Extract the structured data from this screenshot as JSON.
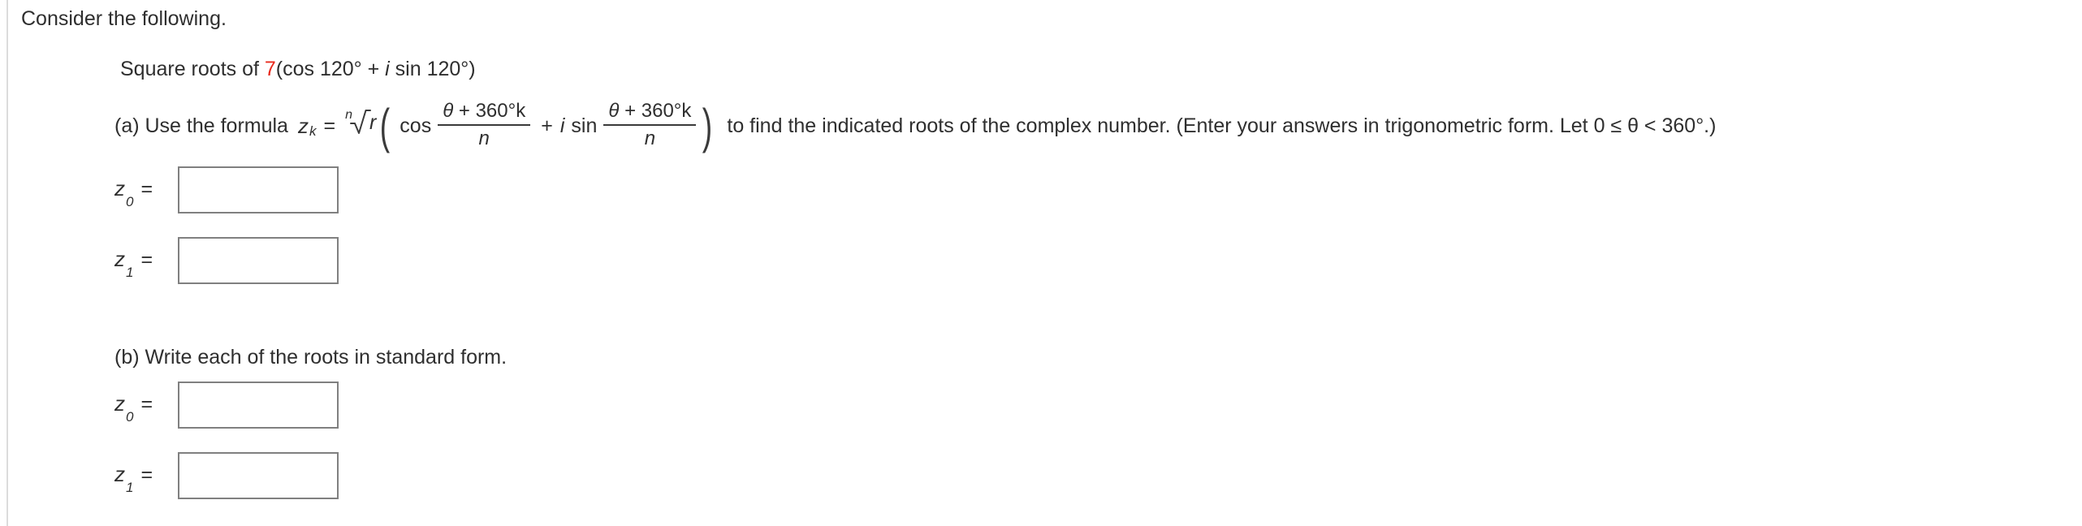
{
  "prompt": {
    "consider_text": "Consider the following."
  },
  "problem": {
    "lead": "Square roots of ",
    "coefficient": "7",
    "expression_open": "(cos 120° + ",
    "imaginary_unit": "i",
    "expression_close": " sin 120°)"
  },
  "part_a": {
    "lead_text": "(a) Use the formula",
    "formula": {
      "variable": "z",
      "variable_subscript": "k",
      "equals": "=",
      "radical_index": "n",
      "radical_sign": "√",
      "radicand": "r",
      "open_paren": "(",
      "cos_label": "cos",
      "plus": "+",
      "imaginary_unit": "i",
      "sin_label": "sin",
      "numerator": "θ + 360°k",
      "numerator_theta": "θ",
      "numerator_rest": " + 360°k",
      "denominator": "n",
      "close_paren": ")"
    },
    "tail_text": "to find the indicated roots of the complex number. (Enter your answers in trigonometric form. Let 0 ≤ θ < 360°.)",
    "answers": [
      {
        "label_var": "z",
        "label_sub": "0",
        "label_eq": "=",
        "value": "",
        "placeholder": ""
      },
      {
        "label_var": "z",
        "label_sub": "1",
        "label_eq": "=",
        "value": "",
        "placeholder": ""
      }
    ]
  },
  "part_b": {
    "lead_text": "(b) Write each of the roots in standard form.",
    "answers": [
      {
        "label_var": "z",
        "label_sub": "0",
        "label_eq": "=",
        "value": "",
        "placeholder": ""
      },
      {
        "label_var": "z",
        "label_sub": "1",
        "label_eq": "=",
        "value": "",
        "placeholder": ""
      }
    ]
  },
  "colors": {
    "coefficient_red": "#e8291c",
    "text": "#2f2f2f",
    "input_border": "#808080",
    "left_rule": "#dcdcdc",
    "background": "#ffffff"
  }
}
